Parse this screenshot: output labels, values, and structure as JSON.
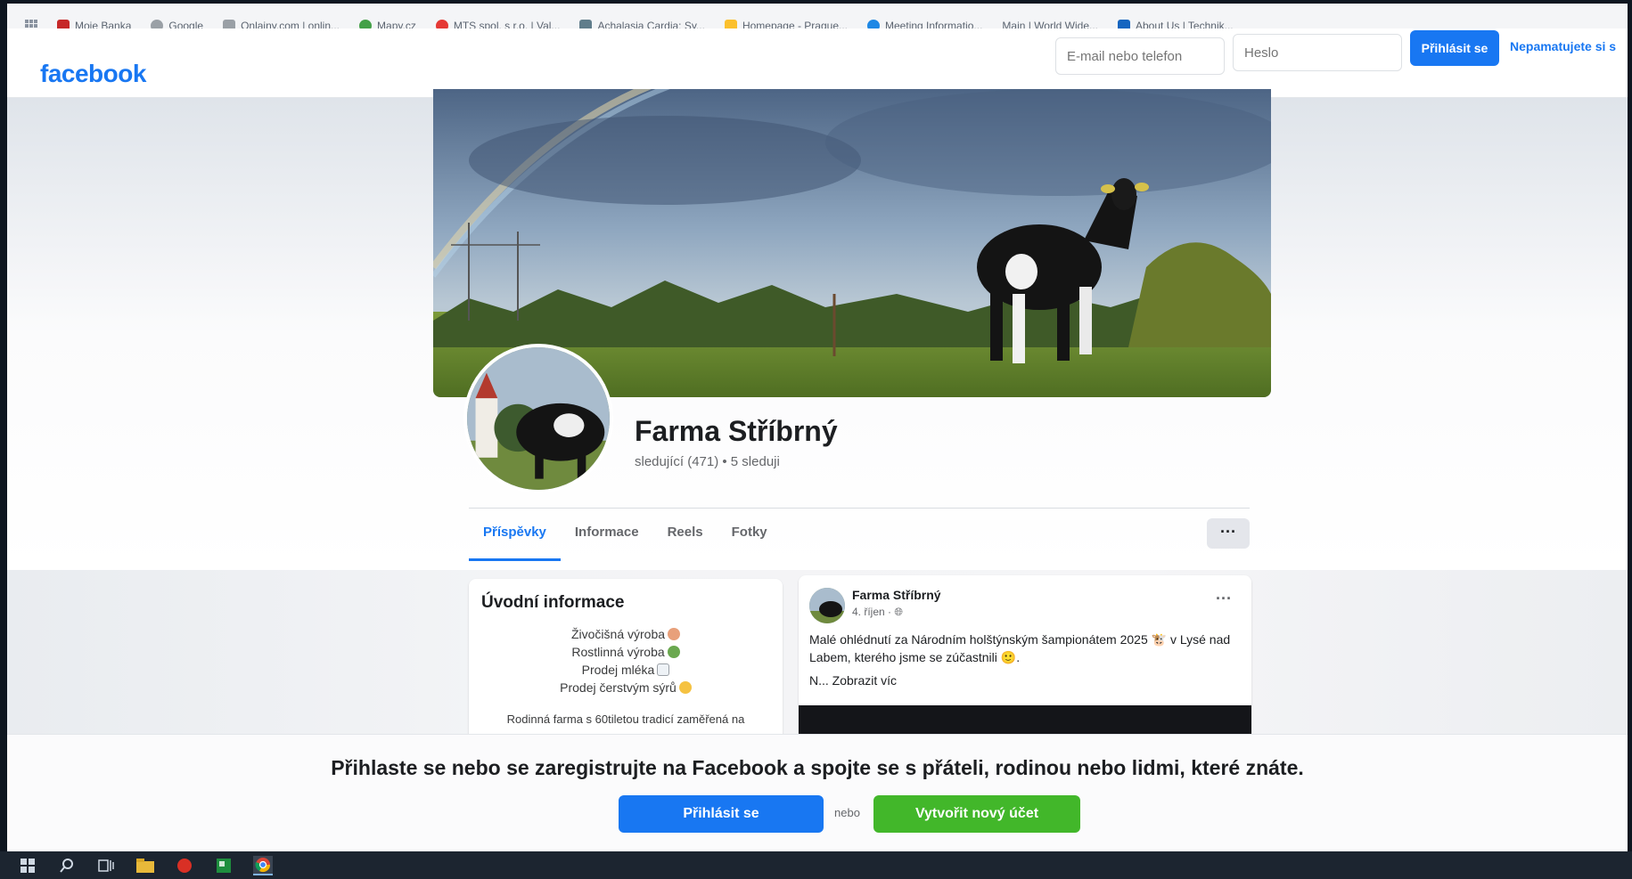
{
  "bookmarks": [
    {
      "label": "Moje Banka",
      "color": "#c62828"
    },
    {
      "label": "Google",
      "color": "#9aa0a6"
    },
    {
      "label": "Onlajny.com | onlin...",
      "color": "#9aa0a6"
    },
    {
      "label": "Mapy.cz",
      "color": "#43a047"
    },
    {
      "label": "MTS spol. s r.o. | Val...",
      "color": "#e53935"
    },
    {
      "label": "Achalasia Cardia: Sy...",
      "color": "#607d8b"
    },
    {
      "label": "Homepage - Prague...",
      "color": "#fbc02d"
    },
    {
      "label": "Meeting Informatio...",
      "color": "#1e88e5"
    },
    {
      "label": "Main | World Wide...",
      "color": "#9aa0a6"
    },
    {
      "label": "About Us | Technik...",
      "color": "#1565c0"
    }
  ],
  "header": {
    "logo": "facebook",
    "email_placeholder": "E-mail nebo telefon",
    "password_placeholder": "Heslo",
    "login_label": "Přihlásit se",
    "forgot_label": "Nepamatujete si s"
  },
  "profile": {
    "name": "Farma Stříbrný",
    "followers": "sledující (471) • 5 sleduji"
  },
  "tabs": [
    {
      "label": "Příspěvky",
      "active": true
    },
    {
      "label": "Informace",
      "active": false
    },
    {
      "label": "Reels",
      "active": false
    },
    {
      "label": "Fotky",
      "active": false
    }
  ],
  "more_label": "···",
  "intro": {
    "title": "Úvodní informace",
    "lines": [
      "Živočišná výroba",
      "Rostlinná výroba",
      "Prodej mléka",
      "Prodej čerstvým sýrů"
    ],
    "description": "Rodinná farma s 60tiletou tradicí zaměřená na"
  },
  "post": {
    "author": "Farma Stříbrný",
    "meta": "4. říjen ·",
    "text": "Malé ohlédnutí za Národním holštýnským šampionátem 2025 🐮 v Lysé nad Labem, kterého jsme se zúčastnili 🙂.",
    "show_more": "N... Zobrazit víc",
    "more_label": "···"
  },
  "banner": {
    "text": "Přihlaste se nebo se zaregistrujte na Facebook a spojte se s přáteli, rodinou nebo lidmi, které znáte.",
    "login_label": "Přihlásit se",
    "or_label": "nebo",
    "create_label": "Vytvořit nový účet"
  },
  "colors": {
    "brand": "#1877f2",
    "create": "#42b72a"
  },
  "taskbar": [
    "windows-icon",
    "search-icon",
    "task-view-icon",
    "file-explorer-icon",
    "pdf-reader-icon",
    "spreadsheet-icon",
    "chrome-icon"
  ]
}
